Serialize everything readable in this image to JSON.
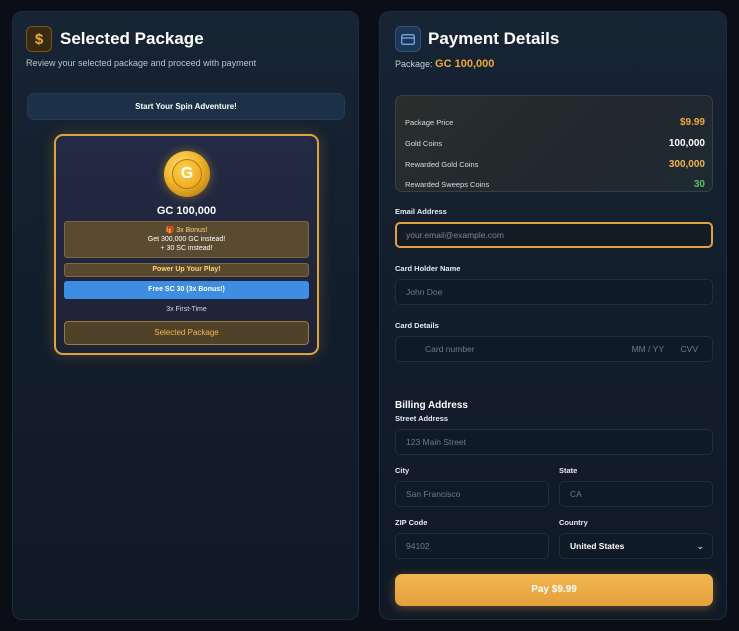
{
  "left": {
    "title": "Selected Package",
    "subtitle": "Review your selected package and proceed with payment",
    "banner": "Start Your Spin Adventure!",
    "card": {
      "coin_letter": "G",
      "amount": "GC 100,000",
      "bonus_line1": "🎁 3x Bonus!",
      "bonus_line2": "Get 300,000 GC instead!",
      "bonus_line3": "+ 30 SC instead!",
      "power_up": "Power Up Your Play!",
      "free_sc": "Free SC 30 (3x Bonus!)",
      "first_time": "3x First-Time",
      "selected_label": "Selected Package"
    }
  },
  "right": {
    "title": "Payment Details",
    "package_label": "Package:",
    "package_value": "GC 100,000",
    "summary": [
      {
        "label": "Package Price",
        "value": "$9.99",
        "color": "#f0a83a"
      },
      {
        "label": "Gold Coins",
        "value": "100,000",
        "color": "#ffffff"
      },
      {
        "label": "Rewarded Gold Coins",
        "value": "300,000",
        "color": "#f0b64a"
      },
      {
        "label": "Rewarded Sweeps Coins",
        "value": "30",
        "color": "#4fc26a"
      }
    ],
    "email": {
      "label": "Email Address",
      "placeholder": "your.email@example.com"
    },
    "card_holder": {
      "label": "Card Holder Name",
      "placeholder": "John Doe"
    },
    "card_details": {
      "label": "Card Details",
      "number_placeholder": "Card number",
      "expiry_placeholder": "MM / YY",
      "cvv_placeholder": "CVV"
    },
    "billing": {
      "heading": "Billing Address",
      "street": {
        "label": "Street Address",
        "placeholder": "123 Main Street"
      },
      "city": {
        "label": "City",
        "placeholder": "San Francisco"
      },
      "state": {
        "label": "State",
        "placeholder": "CA"
      },
      "zip": {
        "label": "ZIP Code",
        "placeholder": "94102"
      },
      "country": {
        "label": "Country",
        "value": "United States"
      }
    },
    "pay_button": "Pay $9.99"
  },
  "icons": {
    "left_header": "dollar-icon",
    "right_header": "credit-card-icon",
    "country": "chevron-down-icon"
  },
  "colors": {
    "accent_gold": "#e0a23c",
    "blue_button": "#3d8ee3",
    "green_value": "#4fc26a"
  }
}
